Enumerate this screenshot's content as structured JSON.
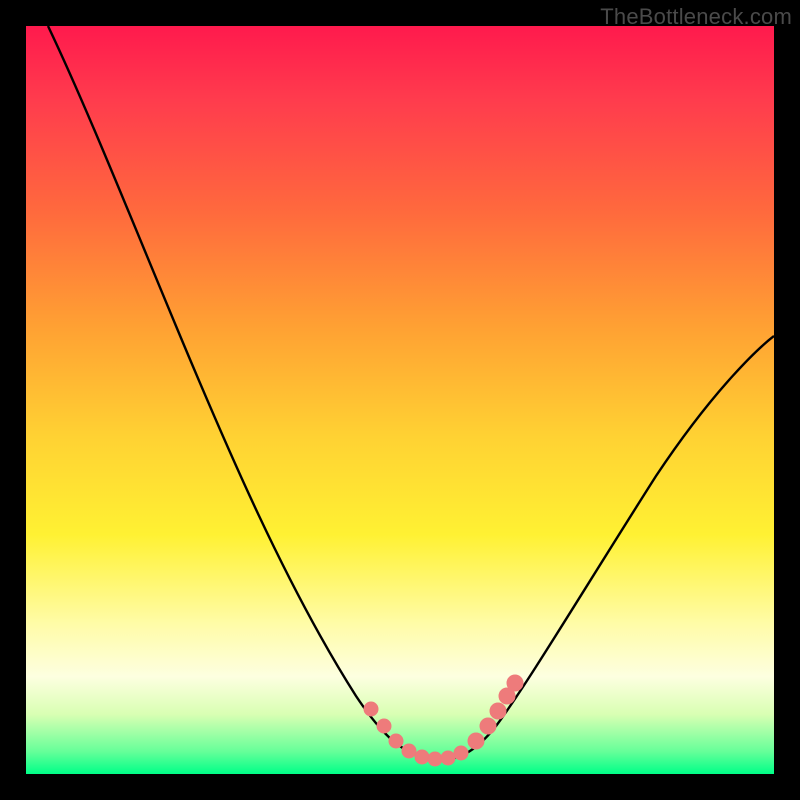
{
  "watermark": {
    "text": "TheBottleneck.com"
  },
  "chart_data": {
    "type": "line",
    "title": "",
    "xlabel": "",
    "ylabel": "",
    "xlim": [
      0,
      100
    ],
    "ylim": [
      0,
      100
    ],
    "grid": false,
    "legend": false,
    "series": [
      {
        "name": "bottleneck-curve",
        "color": "#000000",
        "x": [
          3,
          8,
          13,
          18,
          23,
          28,
          33,
          38,
          42,
          46,
          49,
          52,
          55,
          58,
          62,
          67,
          73,
          80,
          88,
          97,
          100
        ],
        "y": [
          100,
          89,
          78,
          68,
          58,
          48,
          38,
          28,
          19,
          11,
          6,
          3,
          2,
          3,
          7,
          14,
          23,
          33,
          44,
          55,
          58
        ]
      },
      {
        "name": "highlight-dots",
        "color": "#ee7b7b",
        "type": "scatter",
        "points": [
          {
            "x": 46,
            "y": 8
          },
          {
            "x": 48,
            "y": 5
          },
          {
            "x": 50,
            "y": 3.5
          },
          {
            "x": 52,
            "y": 2.6
          },
          {
            "x": 53.5,
            "y": 2.2
          },
          {
            "x": 55,
            "y": 2.0
          },
          {
            "x": 56.5,
            "y": 2.2
          },
          {
            "x": 58,
            "y": 2.5
          },
          {
            "x": 60,
            "y": 4
          },
          {
            "x": 61.5,
            "y": 6
          },
          {
            "x": 62.5,
            "y": 8
          },
          {
            "x": 63.5,
            "y": 10
          },
          {
            "x": 64.5,
            "y": 12
          }
        ]
      }
    ],
    "background_gradient": {
      "top": "#ff1a4d",
      "middle": "#ffd233",
      "bottom": "#00ff88"
    }
  }
}
